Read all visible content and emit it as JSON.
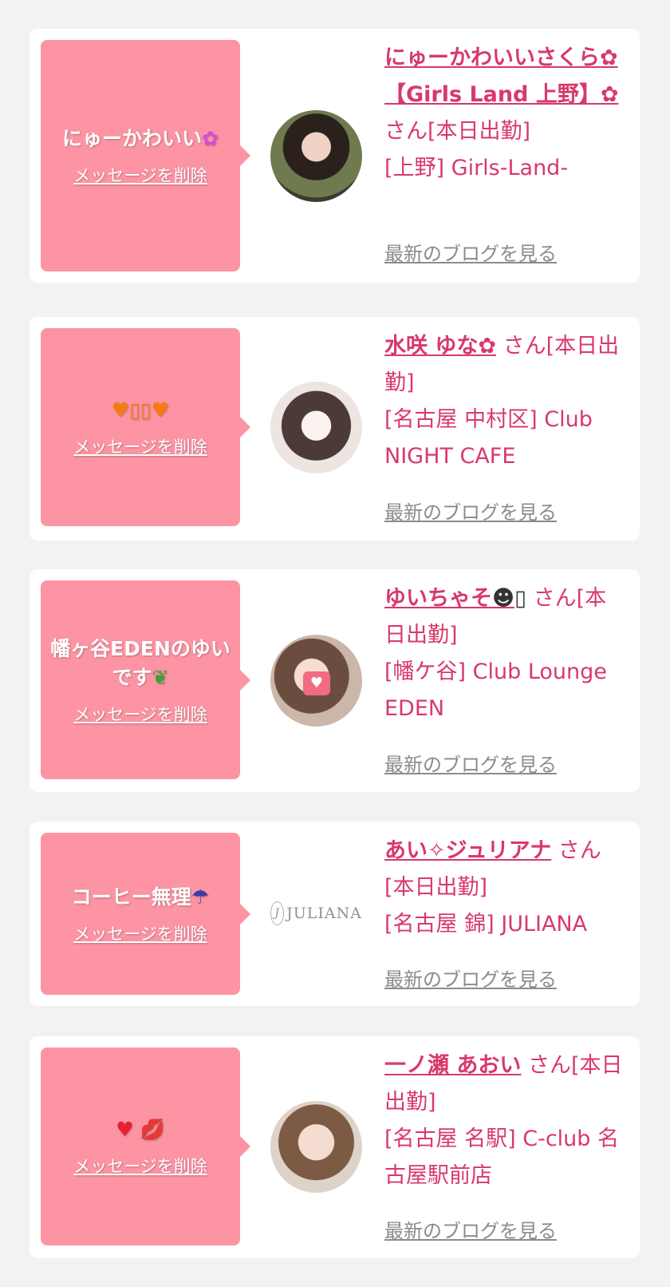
{
  "messages": [
    {
      "bubble_title": "にゅーかわいい",
      "bubble_emoji": "✿",
      "delete_label": "メッセージを削除",
      "name": "にゅーかわいいさくら✿【Girls Land 上野】✿",
      "honorific": "さん[本日出勤]",
      "shop": "[上野] Girls-Land-",
      "blog_label": "最新のブログを見る"
    },
    {
      "bubble_title": "",
      "bubble_emoji": "♥▯▯♥",
      "delete_label": "メッセージを削除",
      "name": "水咲 ゆな✿",
      "honorific": "さん[本日出勤]",
      "shop": "[名古屋 中村区] Club NIGHT CAFE",
      "blog_label": "最新のブログを見る"
    },
    {
      "bubble_title": "幡ヶ谷EDENのゆいです",
      "bubble_emoji": "❦",
      "delete_label": "メッセージを削除",
      "name": "ゆいちゃそ",
      "name_emoji": "☻▯",
      "honorific": "さん[本日出勤]",
      "shop": "[幡ケ谷] Club Lounge EDEN",
      "blog_label": "最新のブログを見る"
    },
    {
      "bubble_title": "コーヒー無理",
      "bubble_emoji": "☂",
      "delete_label": "メッセージを削除",
      "name": "あい✧ジュリアナ",
      "honorific": "さん[本日出勤]",
      "shop": "[名古屋 錦] JULIANA",
      "blog_label": "最新のブログを見る",
      "logo_text": "JULIANA"
    },
    {
      "bubble_title": "",
      "bubble_emoji": "♥ 💋",
      "delete_label": "メッセージを削除",
      "name": "一ノ瀬 あおい",
      "honorific": "さん[本日出勤]",
      "shop": "[名古屋 名駅] C-club 名古屋駅前店",
      "blog_label": "最新のブログを見る"
    }
  ],
  "colors": {
    "background": "#f2f2f2",
    "bubble": "#fc94a4",
    "name_text": "#d8396a",
    "blog_link": "#8b8b8b"
  }
}
